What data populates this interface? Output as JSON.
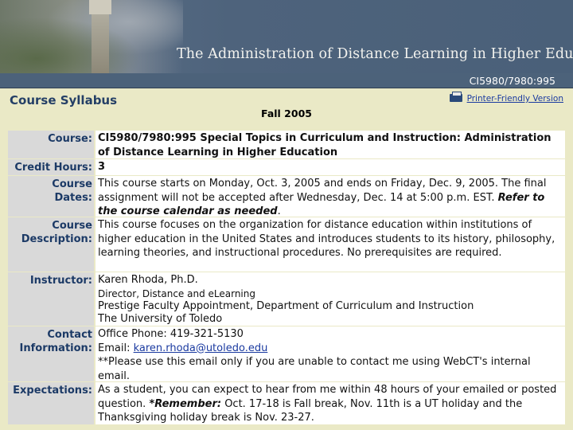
{
  "banner": {
    "title": "The Administration of Distance Learning in Higher Education",
    "course_code": "CI5980/7980:995"
  },
  "heading": "Course Syllabus",
  "printer_link": "Printer-Friendly Version",
  "term": "Fall 2005",
  "rows": {
    "course": {
      "label": "Course:",
      "value": "CI5980/7980:995 Special Topics in Curriculum and Instruction: Administration of Distance Learning in Higher Education"
    },
    "credit_hours": {
      "label": "Credit Hours:",
      "value": "3"
    },
    "course_dates": {
      "label_1": "Course",
      "label_2": "Dates:",
      "text": "This course starts on Monday, Oct. 3, 2005 and ends on Friday, Dec. 9, 2005. The final assignment will not be accepted after Wednesday, Dec. 14 at 5:00 p.m. EST. ",
      "emphasis": "Refer to the course calendar as needed",
      "end": "."
    },
    "course_description": {
      "label_1": "Course",
      "label_2": "Description:",
      "value": "This course focuses on the organization for distance education within institutions of higher education in the United States and introduces students to its history, philosophy, learning theories, and instructional procedures. No prerequisites are required."
    },
    "instructor": {
      "label": "Instructor:",
      "name": "Karen Rhoda, Ph.D.",
      "line2": "Director, Distance and eLearning",
      "line3": "Prestige Faculty Appointment, Department of Curriculum and Instruction",
      "line4": "The University of Toledo"
    },
    "contact": {
      "label_1": "Contact",
      "label_2": "Information:",
      "phone": "Office Phone: 419-321-5130",
      "email_prefix": "Email: ",
      "email": "karen.rhoda@utoledo.edu",
      "note": "**Please use this email only if you are unable to contact me using WebCT's internal email."
    },
    "expectations": {
      "label": "Expectations:",
      "text": "As a student, you can expect to hear from me within 48 hours of your emailed or posted question. ",
      "emphasis": "*Remember:",
      "end": " Oct. 17-18 is Fall break, Nov. 11th is a UT holiday and the Thanksgiving holiday break is Nov. 23-27."
    }
  }
}
